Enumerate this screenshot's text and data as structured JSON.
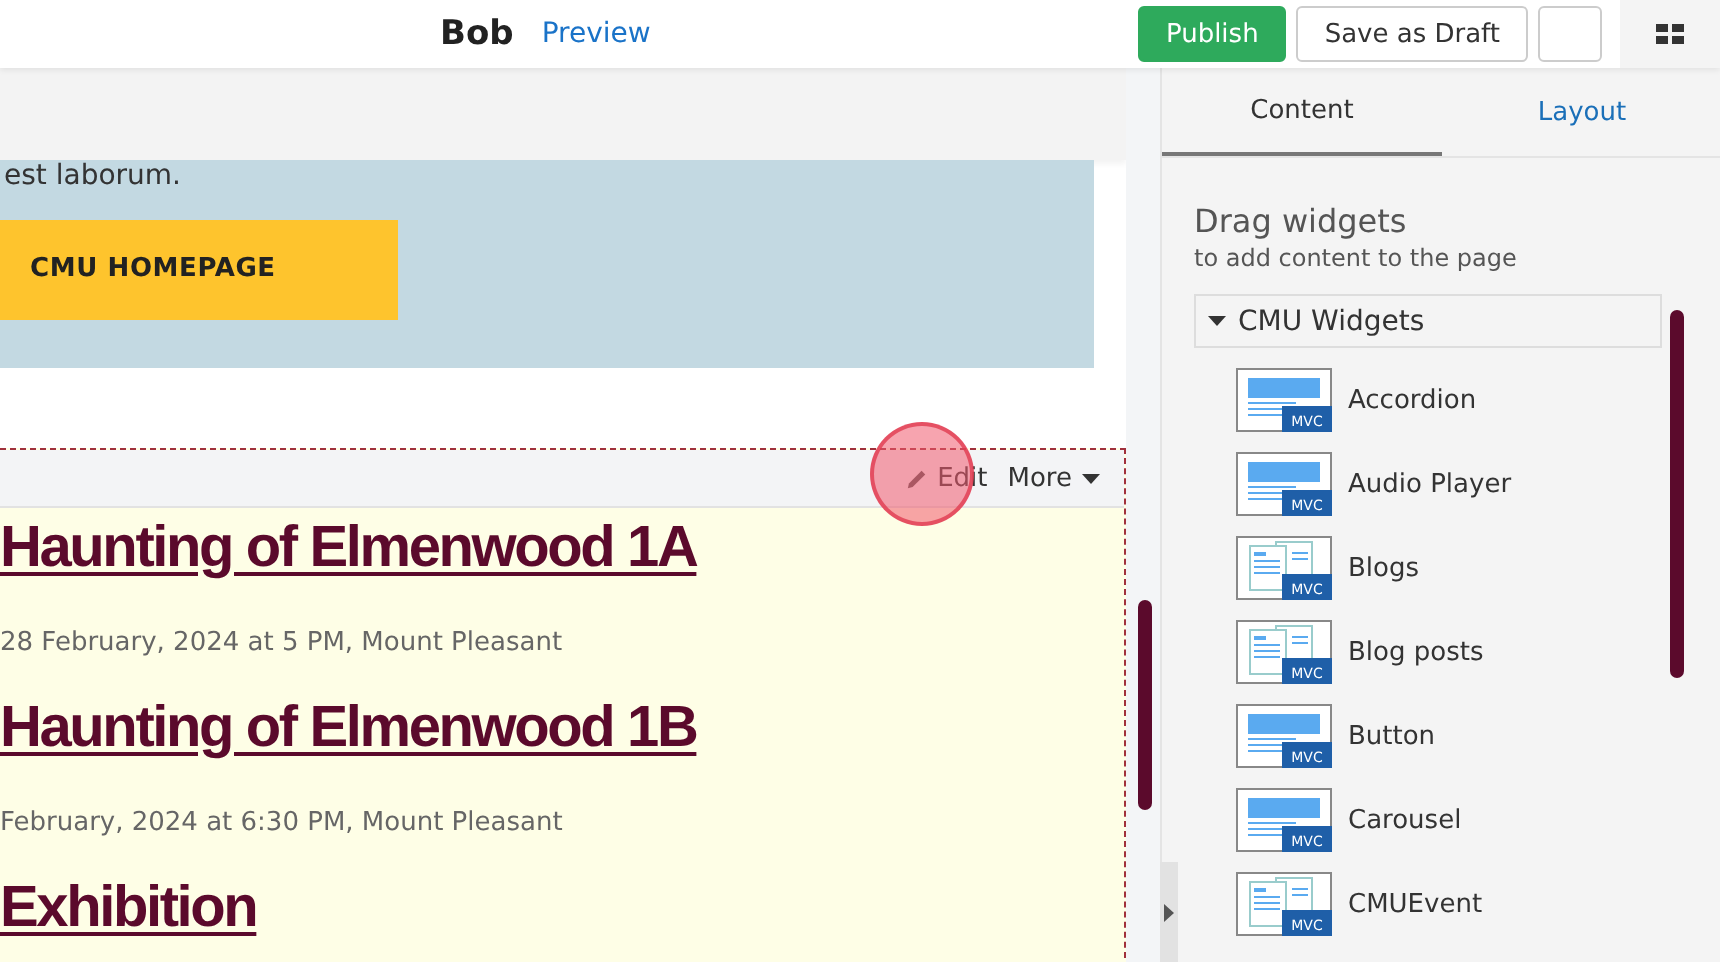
{
  "header": {
    "title": "Bob",
    "preview_link": "Preview",
    "buttons": [
      "Publish",
      "Save as Draft"
    ]
  },
  "page": {
    "paragraph_end": "est laborum.",
    "cta_button": "CMU HOMEPAGE",
    "widget_toolbar": {
      "edit": "Edit",
      "more": "More"
    },
    "events": [
      {
        "title": "Haunting of Elmenwood 1A",
        "date": "28 February, 2024 at 5 PM, Mount Pleasant"
      },
      {
        "title": "Haunting of Elmenwood 1B",
        "date": "February, 2024 at 6:30 PM, Mount Pleasant"
      },
      {
        "title": "Exhibition"
      }
    ]
  },
  "sidebar": {
    "tabs": [
      {
        "label": "Content",
        "selected": true
      },
      {
        "label": "Layout",
        "selected": false
      }
    ],
    "heading": "Drag widgets",
    "subheading": "to add content to the page",
    "group": {
      "label": "CMU Widgets",
      "expanded": true,
      "items": [
        {
          "label": "Accordion",
          "kind": "layout",
          "badge": "MVC"
        },
        {
          "label": "Audio Player",
          "kind": "layout",
          "badge": "MVC"
        },
        {
          "label": "Blogs",
          "kind": "list",
          "badge": "MVC"
        },
        {
          "label": "Blog posts",
          "kind": "list",
          "badge": "MVC"
        },
        {
          "label": "Button",
          "kind": "layout",
          "badge": "MVC"
        },
        {
          "label": "Carousel",
          "kind": "layout",
          "badge": "MVC"
        },
        {
          "label": "CMUEvent",
          "kind": "list",
          "badge": "MVC"
        }
      ]
    }
  }
}
